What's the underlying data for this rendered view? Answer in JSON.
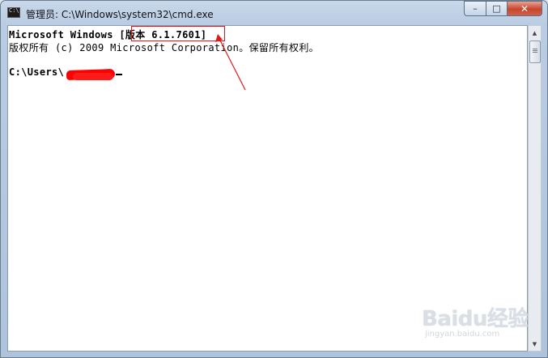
{
  "window": {
    "title": "管理员: C:\\Windows\\system32\\cmd.exe",
    "controls": {
      "minimize": "–",
      "maximize": "□",
      "close": "✕"
    }
  },
  "console": {
    "line1": "Microsoft Windows [版本 6.1.7601]",
    "line2": "版权所有 (c) 2009 Microsoft Corporation。保留所有权利。",
    "prompt": "C:\\Users\\"
  },
  "watermark": {
    "brand": "Baidu经验",
    "url": "jingyan.baidu.com"
  },
  "colors": {
    "annotation": "#e01818",
    "console_bg": "#ffffff",
    "close": "#c7452c"
  },
  "icons": {
    "app": "cmd-icon",
    "up": "scroll-up-arrow-icon",
    "down": "scroll-down-arrow-icon"
  }
}
